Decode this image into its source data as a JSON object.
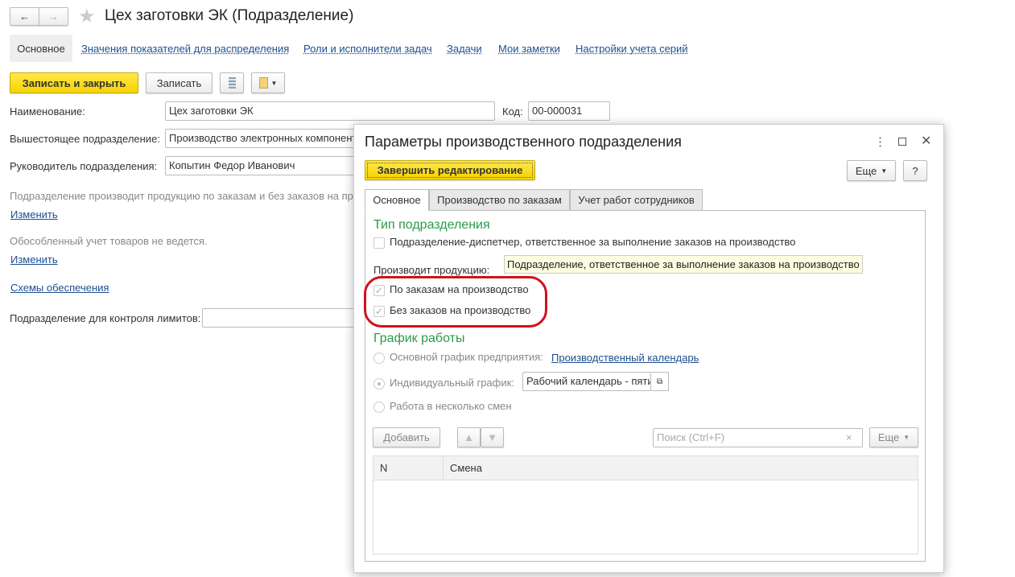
{
  "window": {
    "title": "Цех заготовки ЭК (Подразделение)",
    "back": "←",
    "forward": "→",
    "star": "★"
  },
  "nav_tabs": [
    "Основное",
    "Значения показателей для распределения",
    "Роли и исполнители задач",
    "Задачи",
    "Мои заметки",
    "Настройки учета серий"
  ],
  "toolbar": {
    "save_close": "Записать и закрыть",
    "save": "Записать"
  },
  "form": {
    "name_label": "Наименование:",
    "name_value": "Цех заготовки ЭК",
    "code_label": "Код:",
    "code_value": "00-000031",
    "parent_label": "Вышестоящее подразделение:",
    "parent_value": "Производство электронных компонентов",
    "head_label": "Руководитель подразделения:",
    "head_value": "Копытин Федор Иванович",
    "production_note": "Подразделение производит продукцию по заказам и без заказов на производство",
    "change1": "Изменить",
    "separate_note": "Обособленный учет товаров не ведется.",
    "change2": "Изменить",
    "schemes": "Схемы обеспечения",
    "limits_label": "Подразделение для контроля лимитов:",
    "limits_value": ""
  },
  "dialog": {
    "title": "Параметры производственного подразделения",
    "finish": "Завершить редактирование",
    "more": "Еще",
    "help": "?",
    "tabs": [
      "Основное",
      "Производство по заказам",
      "Учет работ сотрудников"
    ],
    "type_header": "Тип подразделения",
    "dispatcher_label": "Подразделение-диспетчер, ответственное за выполнение заказов на производство",
    "dispatcher_checked": false,
    "produces_label": "Производит продукцию:",
    "tooltip": "Подразделение, ответственное за выполнение заказов на производство",
    "by_orders": "По заказам на производство",
    "by_orders_checked": true,
    "without_orders": "Без заказов на производство",
    "without_orders_checked": true,
    "schedule_header": "График работы",
    "main_schedule": "Основной график предприятия:",
    "calendar_link": "Производственный календарь",
    "individual": "Индивидуальный график:",
    "individual_value": "Рабочий календарь - пятидневка",
    "shifts": "Работа в несколько смен",
    "add": "Добавить",
    "search_placeholder": "Поиск (Ctrl+F)",
    "clear": "×",
    "more2": "Еще",
    "columns": [
      "N",
      "Смена"
    ],
    "highlight_color": "#d0121b"
  }
}
